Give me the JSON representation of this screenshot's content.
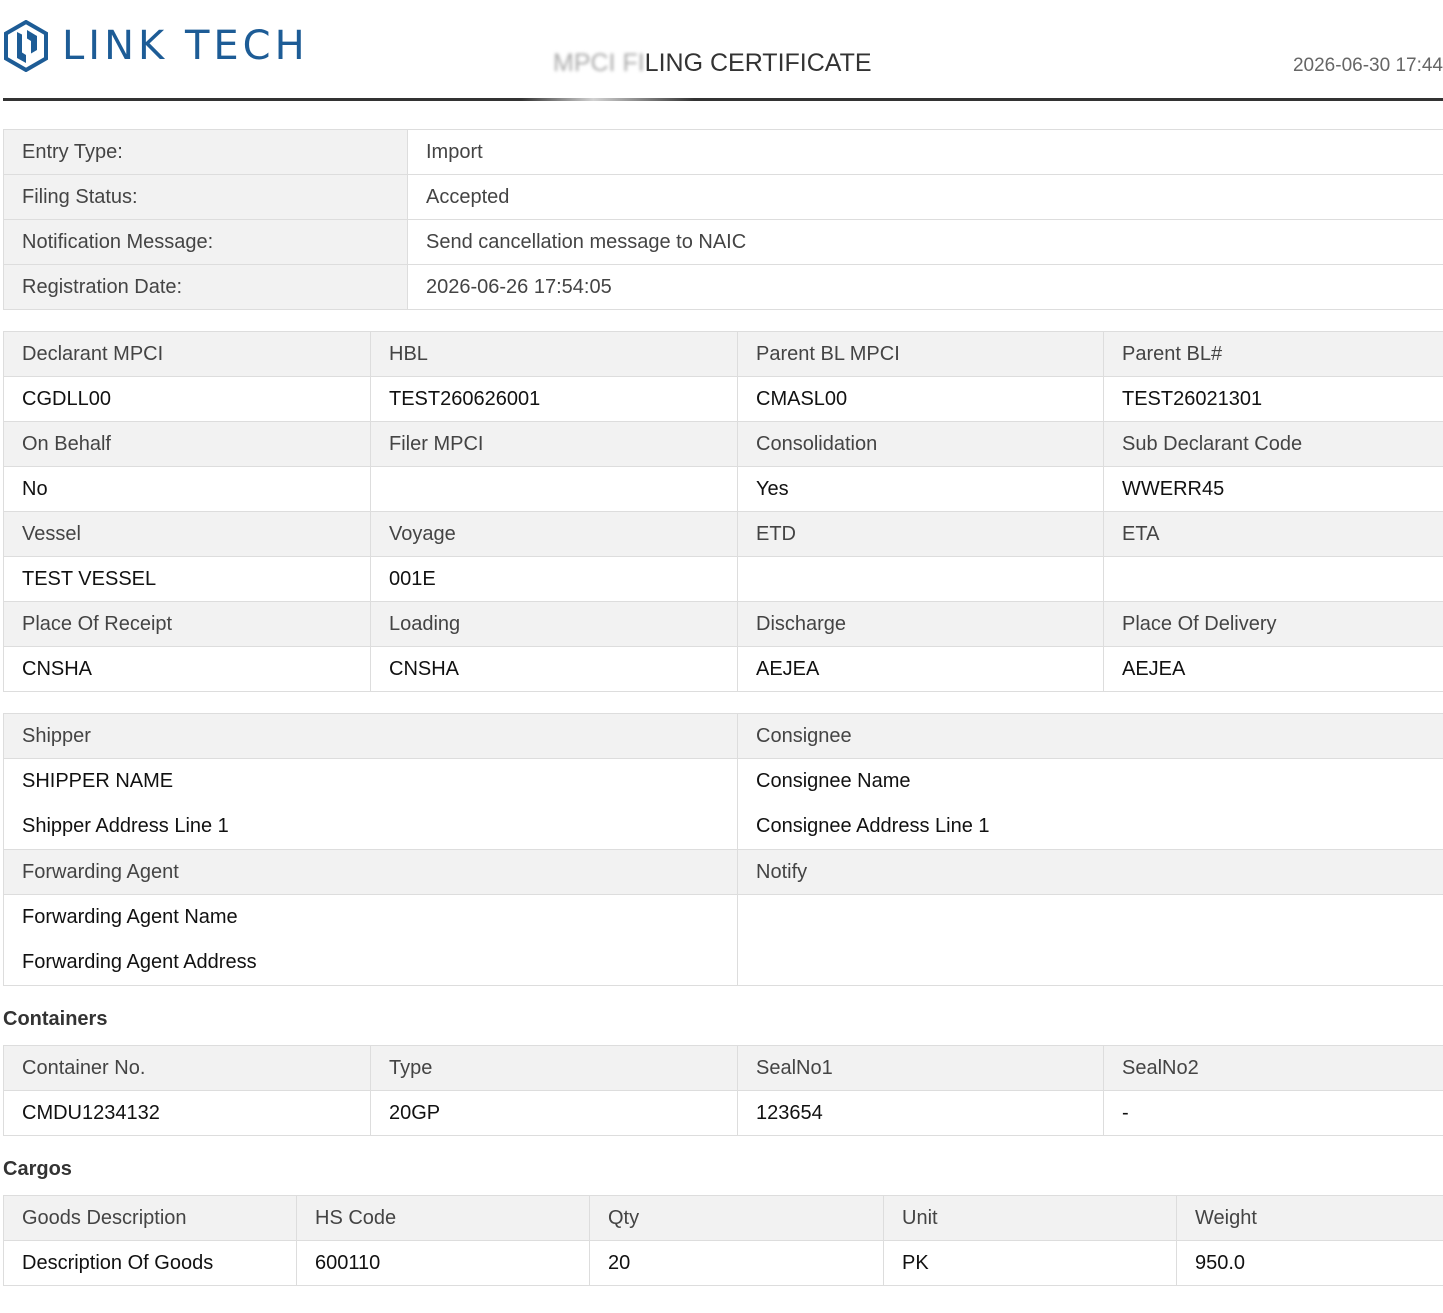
{
  "header": {
    "logo_text": "LINK TECH",
    "title_blurred": "MPCI FI",
    "title_visible": "LING CERTIFICATE",
    "date": "2026-06-30 17:44",
    "brand_color": "#1d5c96"
  },
  "entry_info": [
    {
      "label": "Entry Type:",
      "value": "Import"
    },
    {
      "label": "Filing Status:",
      "value": "Accepted"
    },
    {
      "label": "Notification Message:",
      "value": "Send cancellation message to NAIC"
    },
    {
      "label": "Registration Date:",
      "value": "2026-06-26 17:54:05"
    }
  ],
  "details": [
    {
      "headers": [
        "Declarant MPCI",
        "HBL",
        "Parent BL MPCI",
        "Parent BL#"
      ],
      "values": [
        "CGDLL00",
        "TEST260626001",
        "CMASL00",
        "TEST26021301"
      ]
    },
    {
      "headers": [
        "On Behalf",
        "Filer MPCI",
        "Consolidation",
        "Sub Declarant Code"
      ],
      "values": [
        "No",
        "",
        "Yes",
        "WWERR45"
      ]
    },
    {
      "headers": [
        "Vessel",
        "Voyage",
        "ETD",
        "ETA"
      ],
      "values": [
        "TEST VESSEL",
        "001E",
        "",
        ""
      ]
    },
    {
      "headers": [
        "Place Of Receipt",
        "Loading",
        "Discharge",
        "Place Of Delivery"
      ],
      "values": [
        "CNSHA",
        "CNSHA",
        "AEJEA",
        "AEJEA"
      ]
    }
  ],
  "parties": {
    "shipper": {
      "label": "Shipper",
      "name": "SHIPPER NAME",
      "address": "Shipper Address Line 1"
    },
    "consignee": {
      "label": "Consignee",
      "name": "Consignee Name",
      "address": "Consignee Address Line 1"
    },
    "forwarding_agent": {
      "label": "Forwarding Agent",
      "name": "Forwarding Agent Name",
      "address": "Forwarding Agent Address"
    },
    "notify": {
      "label": "Notify"
    }
  },
  "containers": {
    "title": "Containers",
    "headers": [
      "Container No.",
      "Type",
      "SealNo1",
      "SealNo2"
    ],
    "rows": [
      [
        "CMDU1234132",
        "20GP",
        "123654",
        "-"
      ]
    ]
  },
  "cargos": {
    "title": "Cargos",
    "headers": [
      "Goods Description",
      "HS Code",
      "Qty",
      "Unit",
      "Weight"
    ],
    "rows": [
      [
        "Description Of Goods",
        "600110",
        "20",
        "PK",
        "950.0"
      ]
    ]
  }
}
